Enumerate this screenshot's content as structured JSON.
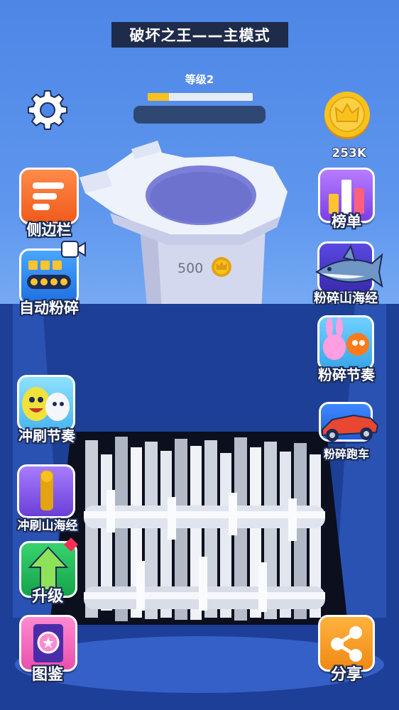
{
  "header": {
    "title": "破坏之王——主模式"
  },
  "level": {
    "label": "等级2",
    "progress": 0.2
  },
  "coins": {
    "amount": "253K"
  },
  "item": {
    "price": "500"
  },
  "left_buttons": {
    "sidebar": "侧边栏",
    "auto_crush": "自动粉碎",
    "flush_rhythm": "冲刷节奏",
    "flush_myth": "冲刷山海经",
    "upgrade": "升级",
    "collection": "图鉴"
  },
  "right_buttons": {
    "leaderboard": "榜单",
    "crush_myth": "粉碎山海经",
    "crush_rhythm": "粉碎节奏",
    "crush_car": "粉碎跑车",
    "share": "分享"
  },
  "colors": {
    "sky": "#5f97ee",
    "shredder_body": "#1d3f95",
    "coin": "#f7c21d",
    "upgrade_arrow": "#6fd13d"
  }
}
